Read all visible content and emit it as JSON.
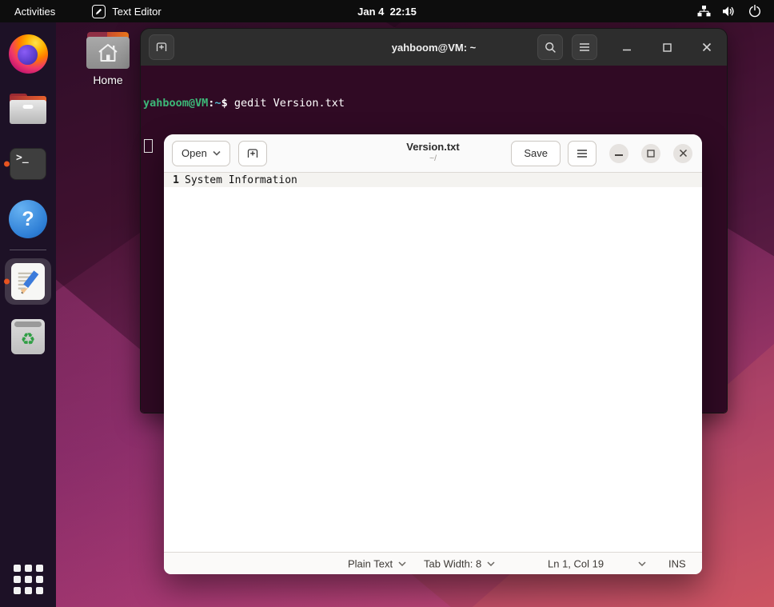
{
  "topbar": {
    "activities_label": "Activities",
    "focused_app_label": "Text Editor",
    "clock": "Jan 4  22:15"
  },
  "desktop": {
    "home_label": "Home"
  },
  "icon_glyphs": {
    "terminal_prompt": ">_",
    "help_question": "?",
    "recycle": "♻"
  },
  "terminal": {
    "title": "yahboom@VM: ~",
    "prompt_user_host": "yahboom@VM",
    "prompt_colon": ":",
    "prompt_path": "~",
    "prompt_dollar": "$ ",
    "command": "gedit Version.txt"
  },
  "gedit": {
    "open_label": "Open",
    "title": "Version.txt",
    "subtitle": "~/",
    "save_label": "Save",
    "line_number": "1",
    "line_text": "System Information",
    "statusbar": {
      "language": "Plain Text",
      "tab_width": "Tab Width: 8",
      "position": "Ln 1, Col 19",
      "mode": "INS"
    }
  },
  "colors": {
    "terminal_bg": "#300a24",
    "terminal_header": "#2d2d2d",
    "prompt_green": "#3cb878",
    "prompt_blue": "#53b9ce",
    "accent_orange": "#e95420",
    "gedit_header": "#fafafa"
  }
}
